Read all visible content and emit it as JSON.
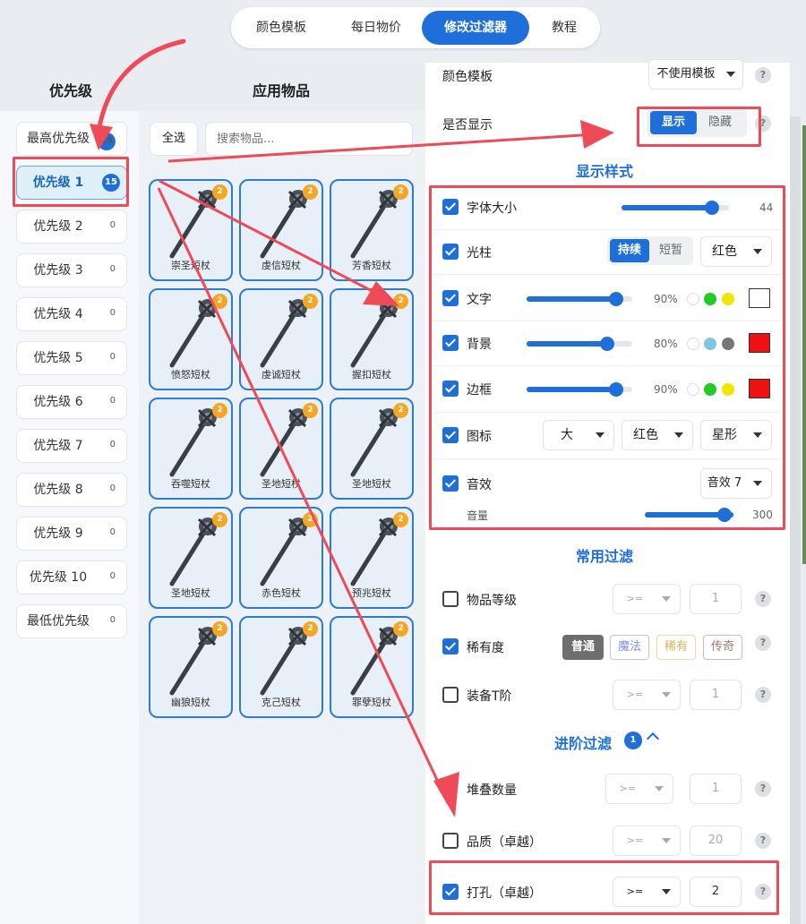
{
  "tabs": [
    {
      "label": "颜色模板",
      "active": false
    },
    {
      "label": "每日物价",
      "active": false
    },
    {
      "label": "修改过滤器",
      "active": true
    },
    {
      "label": "教程",
      "active": false
    }
  ],
  "priority": {
    "title": "优先级",
    "items": [
      {
        "label": "最高优先级",
        "count": "15"
      },
      {
        "label": "优先级 1",
        "count": "15",
        "active": true
      },
      {
        "label": "优先级 2",
        "count": "0"
      },
      {
        "label": "优先级 3",
        "count": "0"
      },
      {
        "label": "优先级 4",
        "count": "0"
      },
      {
        "label": "优先级 5",
        "count": "0"
      },
      {
        "label": "优先级 6",
        "count": "0"
      },
      {
        "label": "优先级 7",
        "count": "0"
      },
      {
        "label": "优先级 8",
        "count": "0"
      },
      {
        "label": "优先级 9",
        "count": "0"
      },
      {
        "label": "优先级 10",
        "count": "0"
      },
      {
        "label": "最低优先级",
        "count": "0"
      }
    ]
  },
  "items": {
    "title": "应用物品",
    "select_all": "全选",
    "search_placeholder": "搜索物品...",
    "badge": "2",
    "cards": [
      {
        "name": "崇圣短杖"
      },
      {
        "name": "虔信短杖"
      },
      {
        "name": "芳香短杖"
      },
      {
        "name": "愤怒短杖"
      },
      {
        "name": "虔诚短杖"
      },
      {
        "name": "握扣短杖"
      },
      {
        "name": "吞噬短杖"
      },
      {
        "name": "圣地短杖"
      },
      {
        "name": "圣地短杖"
      },
      {
        "name": "圣地短杖"
      },
      {
        "name": "赤色短杖"
      },
      {
        "name": "预兆短杖"
      },
      {
        "name": "幽狼短杖"
      },
      {
        "name": "克己短杖"
      },
      {
        "name": "罪孽短杖"
      }
    ]
  },
  "settings": {
    "color_template": {
      "label": "颜色模板",
      "value": "不使用模板"
    },
    "show": {
      "label": "是否显示",
      "options": [
        "显示",
        "隐藏"
      ],
      "selected": "显示"
    },
    "display_style_title": "显示样式",
    "font_size": {
      "label": "字体大小",
      "checked": true,
      "value": "44",
      "level": 0.84
    },
    "beam": {
      "label": "光柱",
      "checked": true,
      "options": [
        "持续",
        "短暂"
      ],
      "selected": "持续",
      "color": "红色"
    },
    "text": {
      "label": "文字",
      "checked": true,
      "percent": "90%",
      "level": 0.85,
      "dots": [
        "#ffffff",
        "#22cc22",
        "#f2e600"
      ],
      "swatch": "#ffffff"
    },
    "background": {
      "label": "背景",
      "checked": true,
      "percent": "80%",
      "level": 0.76,
      "dots": [
        "#ffffff",
        "#7ec6e6",
        "#777777"
      ],
      "swatch": "#ee1111"
    },
    "border": {
      "label": "边框",
      "checked": true,
      "percent": "90%",
      "level": 0.85,
      "dots": [
        "#ffffff",
        "#22cc22",
        "#f2e600"
      ],
      "swatch": "#ee1111"
    },
    "icon": {
      "label": "图标",
      "checked": true,
      "size": "大",
      "color": "红色",
      "shape": "星形"
    },
    "sound": {
      "label": "音效",
      "checked": true,
      "value": "音效 7",
      "volume_label": "音量",
      "volume": "300",
      "level": 0.99
    },
    "common_filter_title": "常用过滤",
    "item_level": {
      "label": "物品等级",
      "checked": false,
      "op": ">=",
      "value": "1"
    },
    "rarity": {
      "label": "稀有度",
      "checked": true,
      "options": [
        "普通",
        "魔法",
        "稀有",
        "传奇"
      ],
      "selected": "普通"
    },
    "tier": {
      "label": "装备T阶",
      "checked": false,
      "op": ">=",
      "value": "1"
    },
    "advanced_title": "进阶过滤",
    "advanced_count": "1",
    "stack": {
      "label": "堆叠数量",
      "op": ">=",
      "value": "1"
    },
    "quality": {
      "label": "品质（卓越）",
      "checked": false,
      "op": ">=",
      "value": "20"
    },
    "sockets": {
      "label": "打孔（卓越）",
      "checked": true,
      "op": ">=",
      "value": "2"
    },
    "help": "?"
  },
  "colors": {
    "accent": "#1e6fd9",
    "highlight": "#ef4a57",
    "badge_orange": "#f5a623"
  }
}
